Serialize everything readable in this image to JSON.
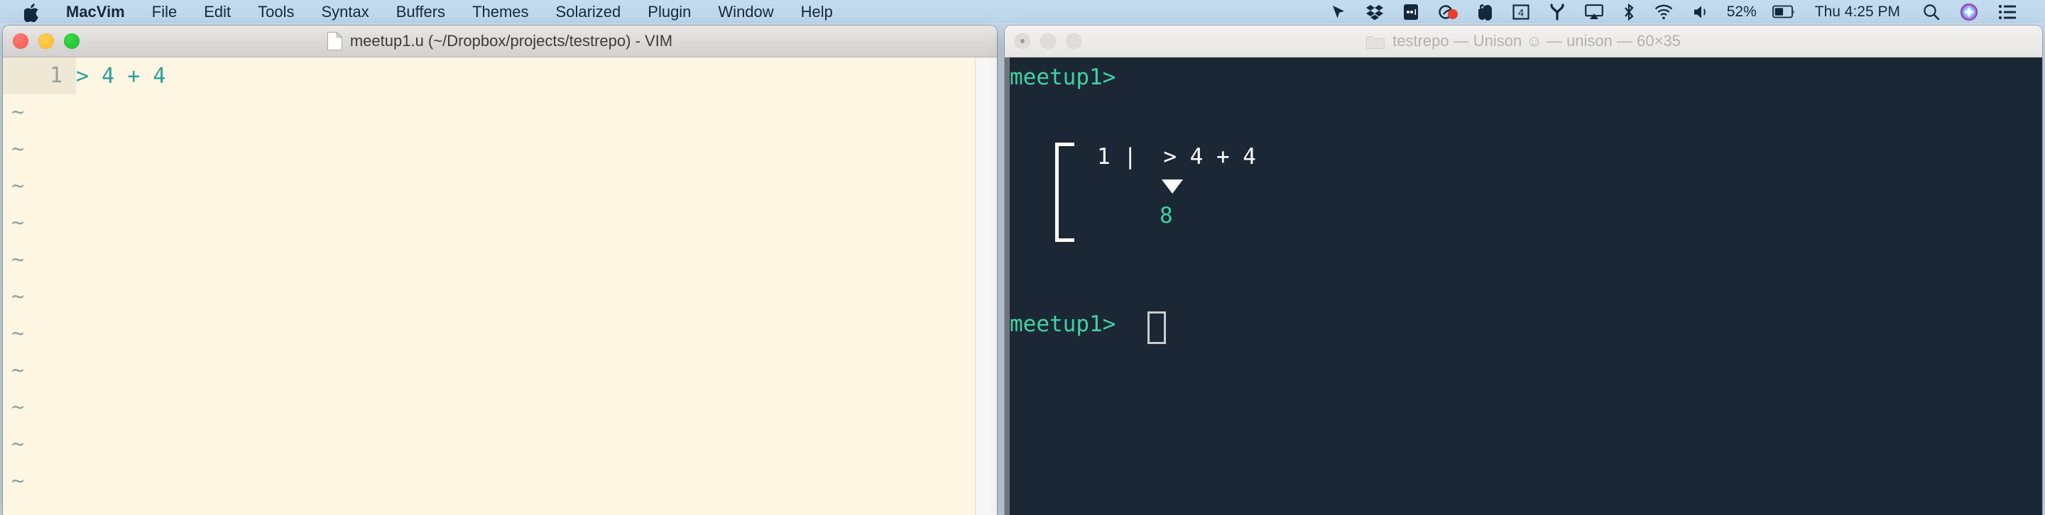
{
  "menubar": {
    "apple_icon": "apple-logo-icon",
    "items": [
      {
        "label": "MacVim",
        "bold": true
      },
      {
        "label": "File",
        "bold": false
      },
      {
        "label": "Edit",
        "bold": false
      },
      {
        "label": "Tools",
        "bold": false
      },
      {
        "label": "Syntax",
        "bold": false
      },
      {
        "label": "Buffers",
        "bold": false
      },
      {
        "label": "Themes",
        "bold": false
      },
      {
        "label": "Solarized",
        "bold": false
      },
      {
        "label": "Plugin",
        "bold": false
      },
      {
        "label": "Window",
        "bold": false
      },
      {
        "label": "Help",
        "bold": false
      }
    ],
    "status_icons": [
      "location-arrow-icon",
      "dropbox-icon",
      "app-dots-icon",
      "screen-record-icon",
      "evernote-icon",
      "calendar-icon",
      "fork-branch-icon",
      "airplay-icon",
      "bluetooth-icon",
      "wifi-icon",
      "volume-icon"
    ],
    "calendar_day": "4",
    "battery_percent": "52%",
    "clock": "Thu 4:25 PM",
    "search_icon": "search-icon",
    "siri_icon": "siri-icon",
    "control_center_icon": "control-center-icon",
    "menubar_text_color": "#14293c",
    "menubar_bg_color": "#bfd8ec"
  },
  "vim_window": {
    "title": "meetup1.u (~/Dropbox/projects/testrepo) - VIM",
    "file_icon": "document-icon",
    "traffic_lights": [
      "close-button",
      "minimize-button",
      "zoom-button"
    ],
    "background_color": "#fdf6e3",
    "code_color": "#2aa198",
    "gutter_color": "#eee8d5",
    "lines": [
      {
        "number": "1",
        "text": "> 4 + 4"
      }
    ],
    "empty_markers": [
      "~",
      "~",
      "~",
      "~",
      "~",
      "~",
      "~",
      "~",
      "~",
      "~",
      "~"
    ]
  },
  "terminal_window": {
    "title": "testrepo — Unison ☺ — unison — 60×35",
    "folder_icon": "folder-icon",
    "traffic_lights": [
      "close-button",
      "minimize-button",
      "zoom-button"
    ],
    "background_color": "#1c2735",
    "prompt_color": "#3fd2a0",
    "output_color": "#ffffff",
    "prompt_top": "meetup1>",
    "watch_expression": "1 |  > 4 + 4",
    "arrow_glyph": "down-triangle-icon",
    "result_value": "8",
    "prompt_bottom": "meetup1>",
    "cursor": "block-cursor"
  }
}
